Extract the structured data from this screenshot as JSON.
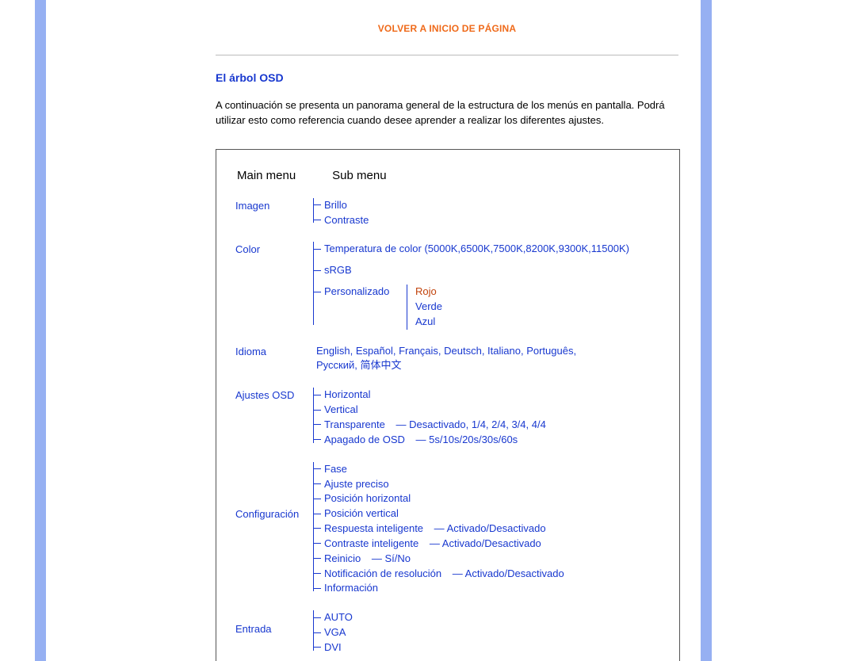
{
  "links": {
    "top": "VOLVER A INICIO DE PÁGINA"
  },
  "section_title": "El árbol OSD",
  "intro": "A continuación se presenta un panorama general de la estructura de los menús en pantalla. Podrá utilizar esto como referencia cuando desee aprender a realizar los diferentes ajustes.",
  "headers": {
    "main": "Main menu",
    "sub": "Sub menu"
  },
  "tree": {
    "imagen": {
      "label": "Imagen",
      "items": [
        "Brillo",
        "Contraste"
      ]
    },
    "color": {
      "label": "Color",
      "temp": "Temperatura de color (5000K,6500K,7500K,8200K,9300K,11500K)",
      "srgb": "sRGB",
      "personalizado": "Personalizado",
      "rgb": {
        "r": "Rojo",
        "g": "Verde",
        "b": "Azul"
      }
    },
    "idioma": {
      "label": "Idioma",
      "langs1": "English, Español, Français, Deutsch, Italiano, Português,",
      "langs2": "Русский, 简体中文"
    },
    "ajustes_osd": {
      "label": "Ajustes OSD",
      "horizontal": "Horizontal",
      "vertical": "Vertical",
      "transparente": "Transparente",
      "transparente_vals": "Desactivado, 1/4, 2/4, 3/4, 4/4",
      "apagado": "Apagado de OSD",
      "apagado_vals": "5s/10s/20s/30s/60s"
    },
    "config": {
      "label": "Configuración",
      "fase": "Fase",
      "ajuste_preciso": "Ajuste preciso",
      "pos_h": "Posición horizontal",
      "pos_v": "Posición vertical",
      "resp": "Respuesta inteligente",
      "resp_v": "Activado/Desactivado",
      "contr": "Contraste inteligente",
      "contr_v": "Activado/Desactivado",
      "reinicio": "Reinicio",
      "reinicio_v": "Sí/No",
      "notif": "Notificación de resolución",
      "notif_v": "Activado/Desactivado",
      "info": "Información"
    },
    "entrada": {
      "label": "Entrada",
      "items": [
        "AUTO",
        "VGA",
        "DVI"
      ]
    }
  }
}
